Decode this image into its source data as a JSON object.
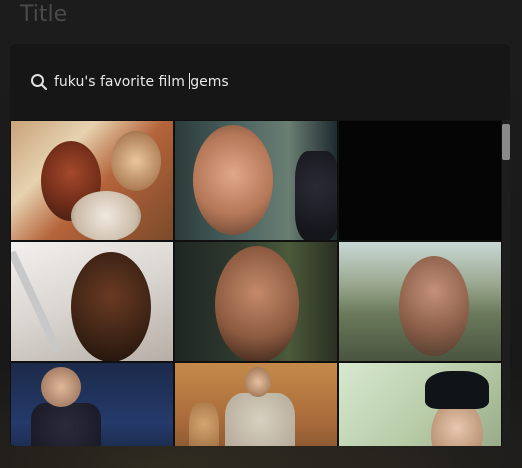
{
  "background": {
    "title": "Title"
  },
  "search": {
    "value": "fuku's favorite film gems",
    "value_before_caret": "fuku's favorite film ",
    "value_after_caret": "gems"
  },
  "results": {
    "items": [
      {
        "name": "gif-result-1"
      },
      {
        "name": "gif-result-2"
      },
      {
        "name": "gif-result-3"
      },
      {
        "name": "gif-result-4"
      },
      {
        "name": "gif-result-5"
      },
      {
        "name": "gif-result-6"
      },
      {
        "name": "gif-result-7"
      },
      {
        "name": "gif-result-8"
      },
      {
        "name": "gif-result-9"
      }
    ]
  },
  "icons": {
    "search": "search-icon"
  },
  "colors": {
    "modal_bg": "#141414",
    "text": "#e8e8e8",
    "placeholder_title": "#4a4a4a",
    "scroll_thumb": "#8a8a8a"
  }
}
